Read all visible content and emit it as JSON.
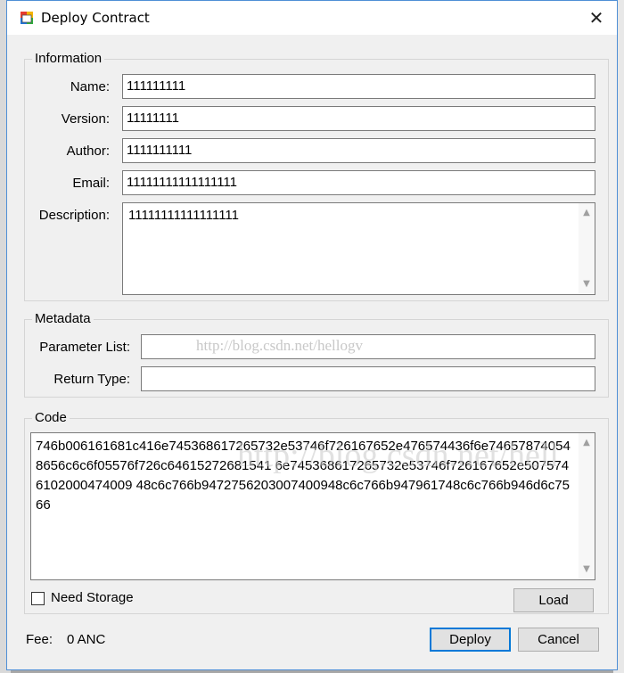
{
  "window": {
    "title": "Deploy Contract",
    "close_glyph": "✕",
    "icon": "app-window-icon"
  },
  "information": {
    "title": "Information",
    "name_label": "Name:",
    "name_value": "111111111",
    "version_label": "Version:",
    "version_value": "11111111",
    "author_label": "Author:",
    "author_value": "1111111111",
    "email_label": "Email:",
    "email_value": "11111111111111111",
    "description_label": "Description:",
    "description_value": "11111111111111111"
  },
  "metadata": {
    "title": "Metadata",
    "param_label": "Parameter List:",
    "param_value": "",
    "return_label": "Return Type:",
    "return_value": ""
  },
  "code": {
    "title": "Code",
    "value": "746b006161681c416e745368617265732e53746f726167652e476574436f6e746578740548656c6c6f05576f726c64615272681541 6e745368617265732e53746f726167652e5075746102000474009 48c6c766b9472756203007400948c6c766b947961748c6c766b946d6c7566"
  },
  "watermark": {
    "text1": "http://blog.csdn.net/hellogv",
    "text2": "http://blog.csdn.net/hell"
  },
  "storage": {
    "label": "Need Storage",
    "checked": false
  },
  "buttons": {
    "load": "Load",
    "deploy": "Deploy",
    "cancel": "Cancel"
  },
  "fee": {
    "label": "Fee:",
    "value": "0 ANC"
  },
  "colors": {
    "accent": "#0078d7",
    "window_border": "#4f8fd6"
  }
}
